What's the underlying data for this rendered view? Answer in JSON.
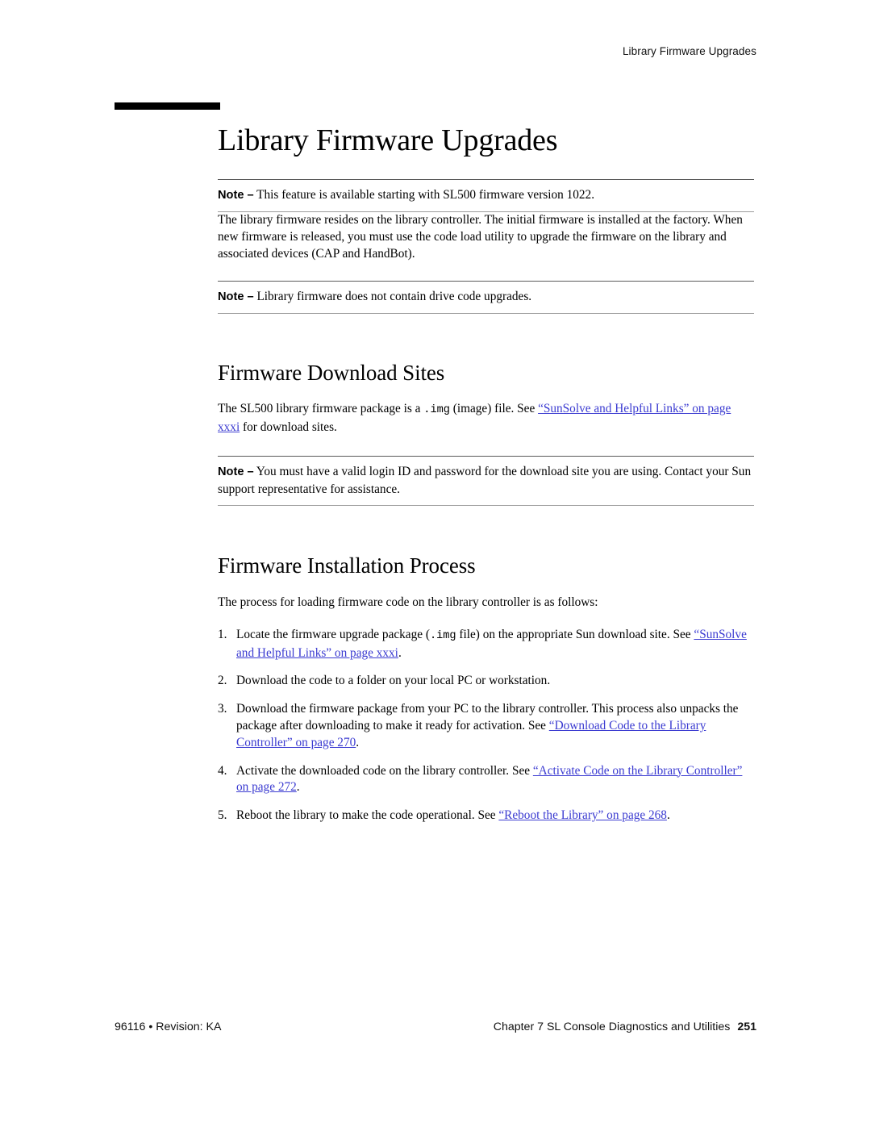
{
  "header": {
    "running_head": "Library Firmware Upgrades"
  },
  "chapter": {
    "title": "Library Firmware Upgrades"
  },
  "notes": {
    "label": "Note –",
    "note1": "This feature is available starting with SL500 firmware version 1022.",
    "note2": "Library firmware does not contain drive code upgrades.",
    "note3_line1": "You must have a valid login ID and password for the download site you are",
    "note3_line2": "using. Contact your Sun support representative for assistance."
  },
  "intro": {
    "paragraph": "The library firmware resides on the library controller. The initial firmware is installed at the factory. When new firmware is released, you must use the code load utility to upgrade the firmware on the library and associated devices (CAP and HandBot)."
  },
  "download_sites": {
    "heading": "Firmware Download Sites",
    "text_before_code": "The SL500 library firmware package is a ",
    "code": ".img",
    "text_after_code": "  (image) file. See ",
    "link": "“SunSolve and Helpful Links” on page xxxi",
    "text_end": " for download sites."
  },
  "installation": {
    "heading": "Firmware Installation Process",
    "lead_in": "The process for loading firmware code on the library controller is as follows:",
    "steps": [
      {
        "num": "1.",
        "text_before_code": "Locate the firmware upgrade package (",
        "code": ".img",
        "text_after_code": " file) on the appropriate Sun download site. See ",
        "link": "“SunSolve and Helpful Links” on page xxxi",
        "text_end": "."
      },
      {
        "num": "2.",
        "text_before_code": "Download the code to a folder on your local PC or workstation.",
        "code": "",
        "text_after_code": "",
        "link": "",
        "text_end": ""
      },
      {
        "num": "3.",
        "text_before_code": "Download the firmware package from your PC to the library controller. This process also unpacks the package after downloading to make it ready for activation. See ",
        "code": "",
        "text_after_code": "",
        "link": "“Download Code to the Library Controller” on page 270",
        "text_end": "."
      },
      {
        "num": "4.",
        "text_before_code": "Activate the downloaded code on the library controller. See ",
        "code": "",
        "text_after_code": "",
        "link": "“Activate Code on the Library Controller” on page 272",
        "text_end": "."
      },
      {
        "num": "5.",
        "text_before_code": "Reboot the library to make the code operational. See ",
        "code": "",
        "text_after_code": "",
        "link": "“Reboot the Library” on page 268",
        "text_end": "."
      }
    ]
  },
  "footer": {
    "left": "96116 • Revision: KA",
    "chapter_label": "Chapter 7 SL Console Diagnostics and Utilities",
    "page_number": "251"
  },
  "colors": {
    "link": "#3b3bd1",
    "text": "#000000",
    "rule_top": "#5a5a5a",
    "rule_bottom": "#9d9d9d"
  }
}
